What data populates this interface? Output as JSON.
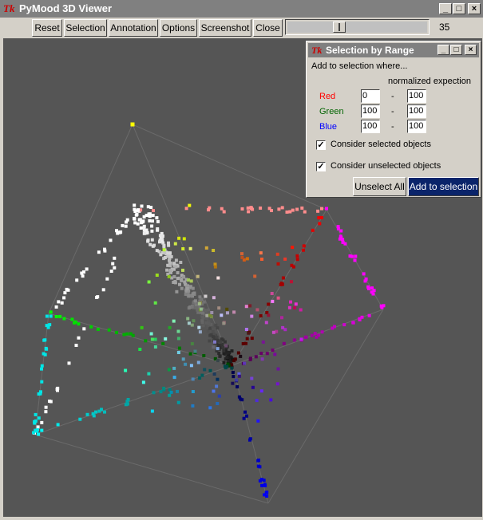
{
  "window": {
    "tk_icon": "Tk",
    "title": "PyMood 3D Viewer",
    "controls": {
      "minimize": "_",
      "maximize": "□",
      "close": "×"
    }
  },
  "toolbar": {
    "buttons": [
      "Reset",
      "Selection",
      "Annotation",
      "Options",
      "Screenshot",
      "Close"
    ],
    "slider_value": "35",
    "slider_fraction": 0.36
  },
  "dialog": {
    "tk_icon": "Tk",
    "title": "Selection by Range",
    "controls": {
      "minimize": "_",
      "maximize": "□",
      "close": "×"
    },
    "prompt": "Add to selection where...",
    "column_header": "normalized expection",
    "rows": [
      {
        "label": "Red",
        "color": "#ff0000",
        "min": "0",
        "max": "100"
      },
      {
        "label": "Green",
        "color": "#006400",
        "min": "100",
        "max": "100"
      },
      {
        "label": "Blue",
        "color": "#0000ff",
        "min": "100",
        "max": "100"
      }
    ],
    "dash": "-",
    "check_selected": {
      "label": "Consider selected objects",
      "checked": true,
      "mark": "✓"
    },
    "check_unselected": {
      "label": "Consider unselected objects",
      "checked": true,
      "mark": "✓"
    },
    "unselect_all": "Unselect All",
    "add_to_selection": "Add to selection"
  },
  "colors": {
    "viewport_bg": "#555555",
    "selected_button_bg": "#0a246a"
  }
}
